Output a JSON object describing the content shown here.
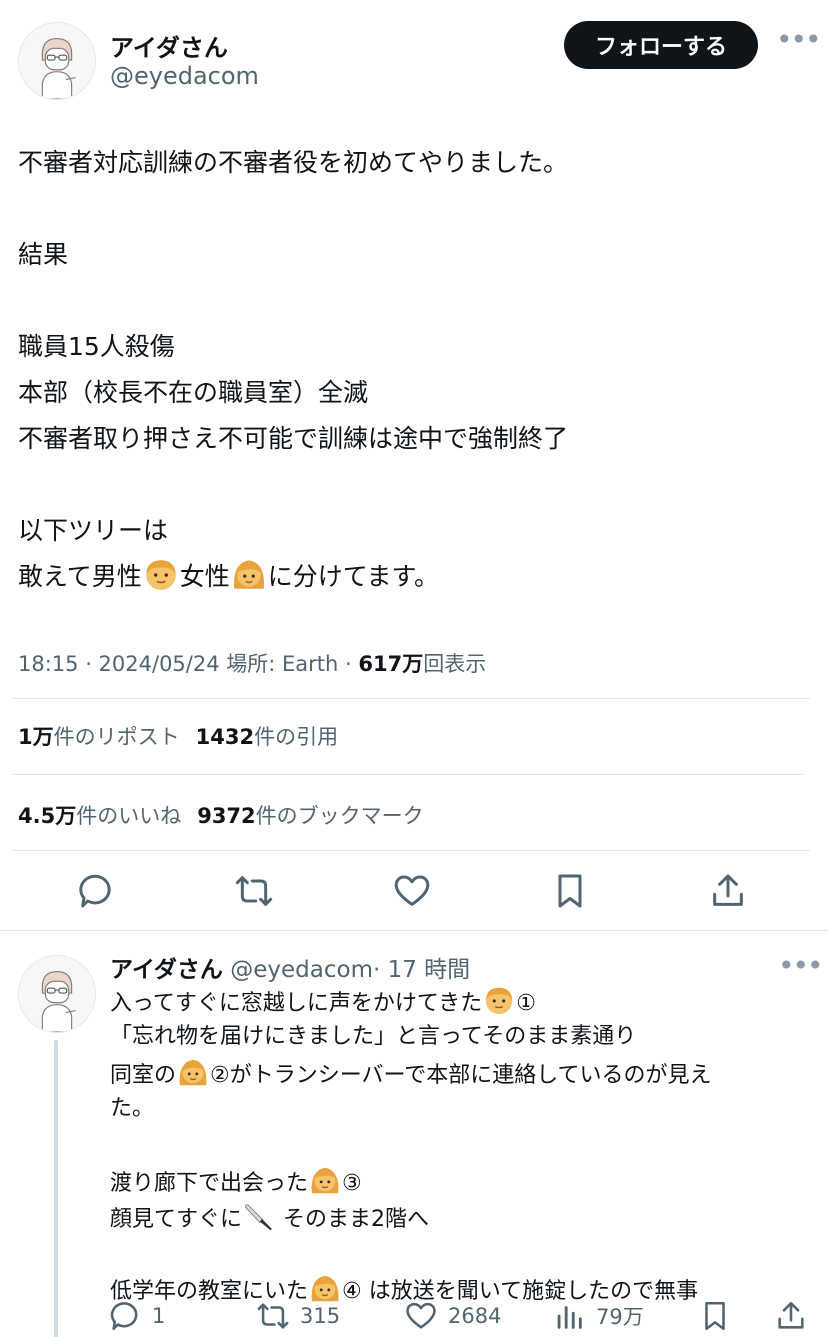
{
  "author": {
    "name": "アイダさん",
    "handle": "@eyedacom",
    "follow_label": "フォローする"
  },
  "tweet": {
    "lines": [
      [
        "不審者対応訓練の不審者役を初めてやりました。"
      ],
      [
        ""
      ],
      [
        "結果"
      ],
      [
        ""
      ],
      [
        "職員15人殺傷"
      ],
      [
        "本部（校長不在の職員室）全滅"
      ],
      [
        "不審者取り押さえ不可能で訓練は途中で強制終了"
      ],
      [
        ""
      ],
      [
        "以下ツリーは"
      ],
      [
        "敢えて男性",
        "女性",
        "に分けてます。"
      ]
    ],
    "time": "18:15 · 2024/05/24",
    "location": "場所: Earth",
    "views_count": "617万",
    "views_label": "回表示",
    "reposts_count": "1万",
    "reposts_label": "件のリポスト",
    "quotes_count": "1432",
    "quotes_label": "件の引用",
    "likes_count": "4.5万",
    "likes_label": "件のいいね",
    "bookmarks_count": "9372",
    "bookmarks_label": "件のブックマーク",
    "icons": [
      "reply-icon",
      "repost-icon",
      "like-icon",
      "bookmark-icon",
      "share-icon"
    ]
  },
  "reply": {
    "name": "アイダさん",
    "handle": "@eyedacom",
    "time": "· 17 時間",
    "lines": [
      [
        "入ってすぐに窓越しに声をかけてきた",
        "①"
      ],
      [
        "「忘れ物を届けにきました」と言ってそのまま素通り"
      ],
      [
        "同室の",
        "②がトランシーバーで本部に連絡しているのが見え"
      ],
      [
        "た。"
      ],
      [
        ""
      ],
      [
        "渡り廊下で出会った",
        "③"
      ],
      [
        "顔見てすぐに",
        " そのまま2階へ"
      ],
      [
        ""
      ],
      [
        "低学年の教室にいた",
        "④ は放送を聞いて施錠したので無事"
      ]
    ],
    "reply_count": "1",
    "repost_count": "315",
    "like_count": "2684",
    "views_count": "79万"
  },
  "colors": {
    "text": "#0f1419",
    "secondary": "#536471",
    "divider": "#e1e5e8",
    "follow_bg": "#0f1419"
  }
}
